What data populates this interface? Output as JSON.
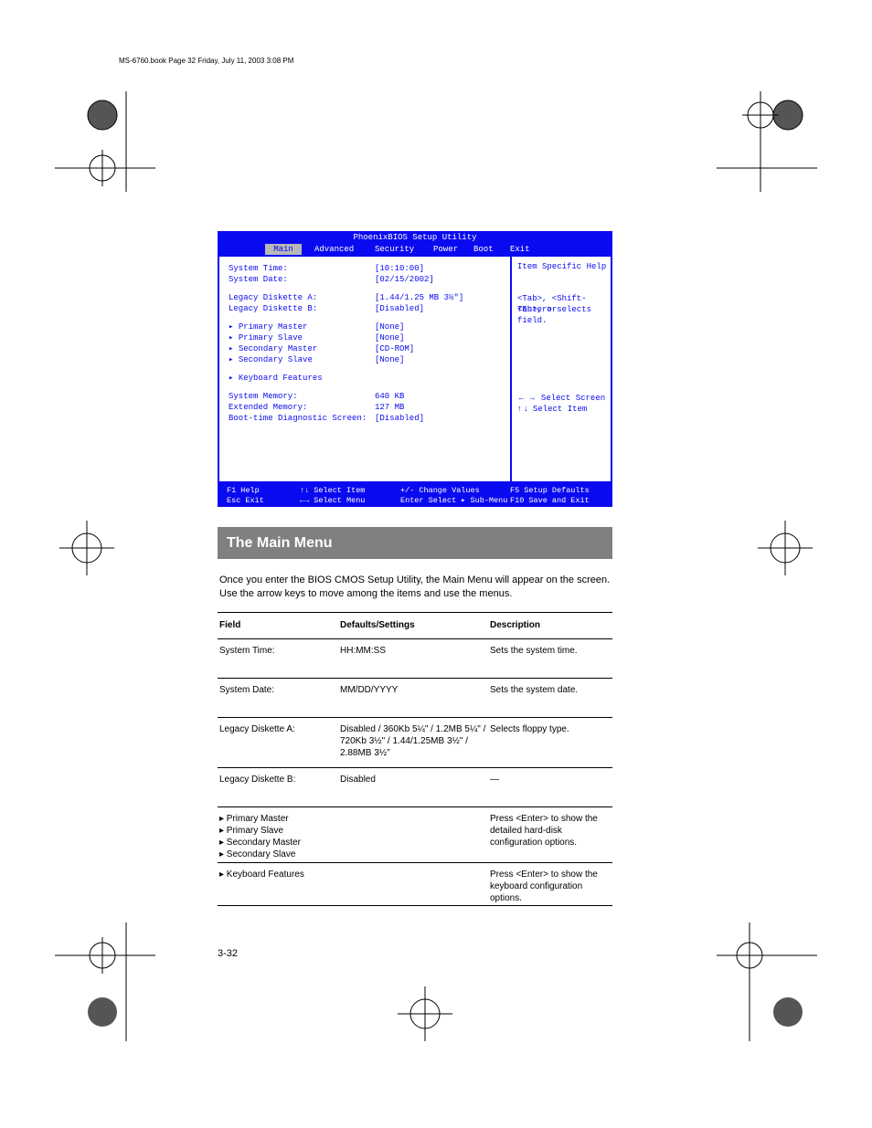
{
  "footer_tag": "MS-6760.book  Page 32  Friday, July 11, 2003  3:08 PM",
  "page_number": "3-32",
  "bios": {
    "title": "PhoenixBIOS Setup Utility",
    "tabs": {
      "main": "Main",
      "advanced": "Advanced",
      "security": "Security",
      "power": "Power",
      "boot": "Boot",
      "exit": "Exit"
    },
    "rows": {
      "system_time": {
        "label": "System Time:",
        "value": "[10:10:00]"
      },
      "system_date": {
        "label": "System Date:",
        "value": "[02/15/2002]"
      },
      "legacy_a": {
        "label": "Legacy Diskette A:",
        "value": "[1.44/1.25 MB  3½\"]"
      },
      "legacy_b": {
        "label": "Legacy Diskette B:",
        "value": "[Disabled]"
      },
      "pm": {
        "label": "Primary Master",
        "value": "[None]"
      },
      "ps": {
        "label": "Primary Slave",
        "value": "[None]"
      },
      "sm": {
        "label": "Secondary Master",
        "value": "[CD-ROM]"
      },
      "ss": {
        "label": "Secondary Slave",
        "value": "[None]"
      },
      "kbd": {
        "label": "Keyboard Features"
      },
      "sysmem": {
        "label": "System Memory:",
        "value": "640 KB"
      },
      "extmem": {
        "label": "Extended Memory:",
        "value": "127 MB"
      },
      "bootsum": {
        "label": "Boot-time Diagnostic Screen:",
        "value": "[Disabled]"
      }
    },
    "help": {
      "title": "Item Specific Help",
      "l1": "<Tab>, <Shift-Tab>, or",
      "l2": "<Enter> selects field.",
      "l3": "     Select Screen",
      "l4": "     Select Item"
    },
    "foot": {
      "f1": "F1  Help",
      "f5": "F5  Setup Defaults",
      "esc": "Esc  Exit",
      "f10": "F10  Save and Exit",
      "selmenu": "←→ Select Menu",
      "selitem": "↑↓ Select Item",
      "chg": "+/-  Change Values",
      "sub": "Enter  Select ▸ Sub-Menu"
    }
  },
  "section": {
    "title": "The Main Menu"
  },
  "intro": "Once you enter the BIOS CMOS Setup Utility, the Main Menu will appear on the screen. Use the arrow keys to move among the items and use the menus.",
  "table": {
    "h1": "Field",
    "h2": "Defaults/Settings",
    "h3": "Description",
    "r1": {
      "c1": "System Time:",
      "c2": "HH:MM:SS",
      "c3": "Sets the system time."
    },
    "r2": {
      "c1": "System Date:",
      "c2": "MM/DD/YYYY",
      "c3": "Sets the system date."
    },
    "r3": {
      "c1": "Legacy Diskette A:",
      "c2": "Disabled / 360Kb 5¼\" / 1.2MB 5¼\" / 720Kb 3½\" / 1.44/1.25MB 3½\" / 2.88MB 3½\"",
      "c3": "Selects floppy type."
    },
    "r4": {
      "c1": "Legacy Diskette B:",
      "c2": "Disabled",
      "c3": "—"
    },
    "r5": {
      "c1": "▸ Primary Master\n▸ Primary Slave\n▸ Secondary Master\n▸ Secondary Slave",
      "c3": "Press <Enter> to show the detailed hard-disk configuration options."
    },
    "r6": {
      "c1": "▸ Keyboard Features",
      "c3": "Press <Enter> to show the keyboard configuration options."
    }
  }
}
